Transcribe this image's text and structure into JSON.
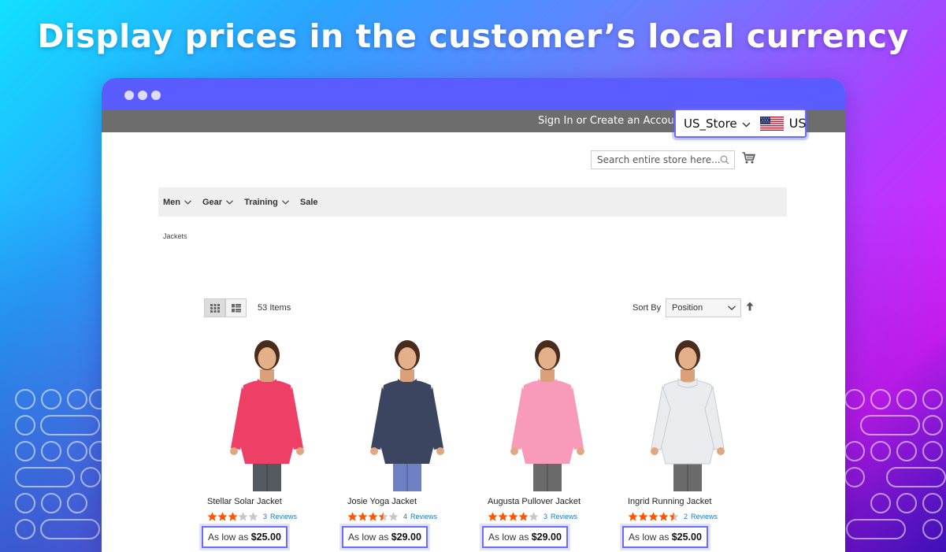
{
  "headline": "Display prices in the customer’s local currency",
  "header": {
    "sign_in": "Sign In",
    "or": "or",
    "create_account": "Create an Account",
    "store_name": "US_Store",
    "currency_code": "US"
  },
  "search": {
    "placeholder": "Search entire store here..."
  },
  "nav": [
    {
      "label": "Men",
      "has_dropdown": true
    },
    {
      "label": "Gear",
      "has_dropdown": true
    },
    {
      "label": "Training",
      "has_dropdown": true
    },
    {
      "label": "Sale",
      "has_dropdown": false
    }
  ],
  "breadcrumb": "Jackets",
  "toolbar": {
    "items_count": "53",
    "items_label": "Items",
    "sort_by_label": "Sort By",
    "sort_value": "Position"
  },
  "products": [
    {
      "name": "Stellar Solar Jacket",
      "rating_stars": 3,
      "reviews_count": "3",
      "reviews_label": "Reviews",
      "price_prefix": "As low as",
      "price": "$25.00",
      "garment_color": "#ee3f66",
      "pants_color": "#555a60"
    },
    {
      "name": "Josie Yoga Jacket",
      "rating_stars": 3.5,
      "reviews_count": "4",
      "reviews_label": "Reviews",
      "price_prefix": "As low as",
      "price": "$29.00",
      "garment_color": "#3b4560",
      "pants_color": "#6f7fc4"
    },
    {
      "name": "Augusta Pullover Jacket",
      "rating_stars": 4,
      "reviews_count": "3",
      "reviews_label": "Reviews",
      "price_prefix": "As low as",
      "price": "$29.00",
      "garment_color": "#f89aba",
      "pants_color": "#6a6a6a"
    },
    {
      "name": "Ingrid Running Jacket",
      "rating_stars": 4.5,
      "reviews_count": "2",
      "reviews_label": "Reviews",
      "price_prefix": "As low as",
      "price": "$25.00",
      "garment_color": "#e9ebee",
      "pants_color": "#6a6a6a"
    }
  ],
  "colors": {
    "accent": "#5a5cff",
    "highlight_border": "#6a6cff",
    "star_filled": "#ff5501",
    "star_empty": "#c7c7c7",
    "link": "#1979c3"
  }
}
